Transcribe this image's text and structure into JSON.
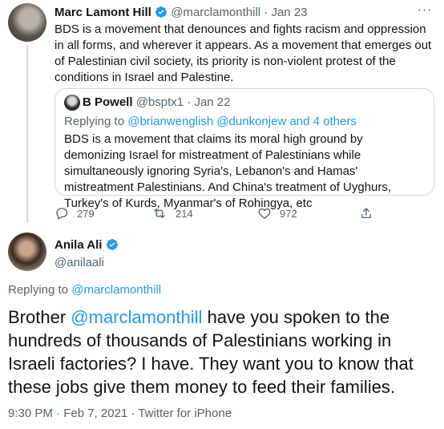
{
  "parent_tweet": {
    "display_name": "Marc Lamont Hill",
    "handle": "@marclamonthill",
    "separator": "·",
    "date": "Jan 23",
    "text": "BDS is a movement that denounces and fights racism and oppression in all forms, and wherever it appears. As a movement that emerges out of Palestinian civil society, its priority is non-violent protest of the conditions in Israel and Palestine.",
    "quoted": {
      "display_name": "B Powell",
      "handle": "@bsptx1",
      "separator": "·",
      "date": "Jan 22",
      "replying_prefix": "Replying to",
      "replying_handles": "@brianwenglish @dunkonjew",
      "replying_suffix": "and 4 others",
      "text": "BDS is a movement that claims its moral high ground by demonizing Israel for mistreatment of Palestinians while simultaneously ignoring Syria's, Lebanon's and Hamas' mistreatment Palestinians. And China's treatment of Uyghurs, Turkey's of Kurds, Myanmar's of Rohingya, etc"
    },
    "actions": {
      "replies": "279",
      "retweets": "214",
      "likes": "972"
    }
  },
  "main_tweet": {
    "display_name": "Anila Ali",
    "handle": "@anilaali",
    "replying_prefix": "Replying to",
    "replying_handle": "@marclamonthill",
    "text_prefix": "Brother",
    "mention": "@marclamonthill",
    "text_rest": "have you spoken to the hundreds of thousands of Palestinians working in Israeli factories? I have. They want you to know that these jobs give them money to feed their families.",
    "timestamp": "9:30 PM · Feb 7, 2021 · Twitter for iPhone"
  },
  "colors": {
    "accent": "#1d9bf0",
    "muted": "#536471",
    "thread_line": "#cfd9de"
  }
}
